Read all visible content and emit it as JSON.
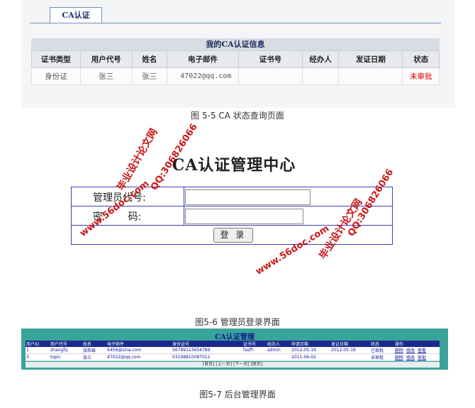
{
  "fig5_5": {
    "tab_label": "CA认证",
    "table_title": "我的CA认证信息",
    "headers": [
      "证书类型",
      "用户代号",
      "姓名",
      "电子邮件",
      "证书号",
      "经办人",
      "发证日期",
      "状态"
    ],
    "row": {
      "cert_type": "身份证",
      "user_code": "张三",
      "name": "张三",
      "email": "47022@qq.com",
      "cert_no": "",
      "handler": "",
      "issue_date": "",
      "status": "未审批"
    },
    "status_color": "#e00000",
    "caption": "图 5-5    CA 状态查询页面"
  },
  "fig5_6": {
    "title": "CA认证管理中心",
    "label_admin_code": "管理员代号:",
    "label_password": "密        码:",
    "login_button": "登 录",
    "caption": "图5-6  管理员登录界面",
    "watermarks": [
      "毕业设计论文网",
      "QQ:306826066",
      "www.56doc.com"
    ]
  },
  "fig5_7": {
    "title": "CA认证管理",
    "headers": [
      "用户ID",
      "用户代号",
      "姓名",
      "电子邮件",
      "身份证号",
      "证书号",
      "经办人",
      "申请日期",
      "发证日期",
      "状态",
      "操作"
    ],
    "rows": [
      {
        "id": "1",
        "code": "zhangfq",
        "name": "张和珠",
        "email": "6456@sina.com",
        "idno": "56789123654789",
        "cert": "fasfh",
        "handler": "admin",
        "apply": "2012-05-19",
        "issue": "2012-05-19",
        "status": "已审批",
        "ops": [
          "删除",
          "修改",
          "查看"
        ]
      },
      {
        "id": "3",
        "code": "topic",
        "name": "张三",
        "email": "47022@qq.com",
        "idno": "03198810087012",
        "cert": "",
        "handler": "",
        "apply": "2011-06-02",
        "issue": "",
        "status": "未审批",
        "ops": [
          "删除",
          "修改",
          "审批"
        ]
      }
    ],
    "pager": "[首页] [上一页] [下一页] [尾页]",
    "panel_color": "#3aa39a",
    "header_color": "#1a2a8c",
    "caption": "图5-7    后台管理界面"
  }
}
